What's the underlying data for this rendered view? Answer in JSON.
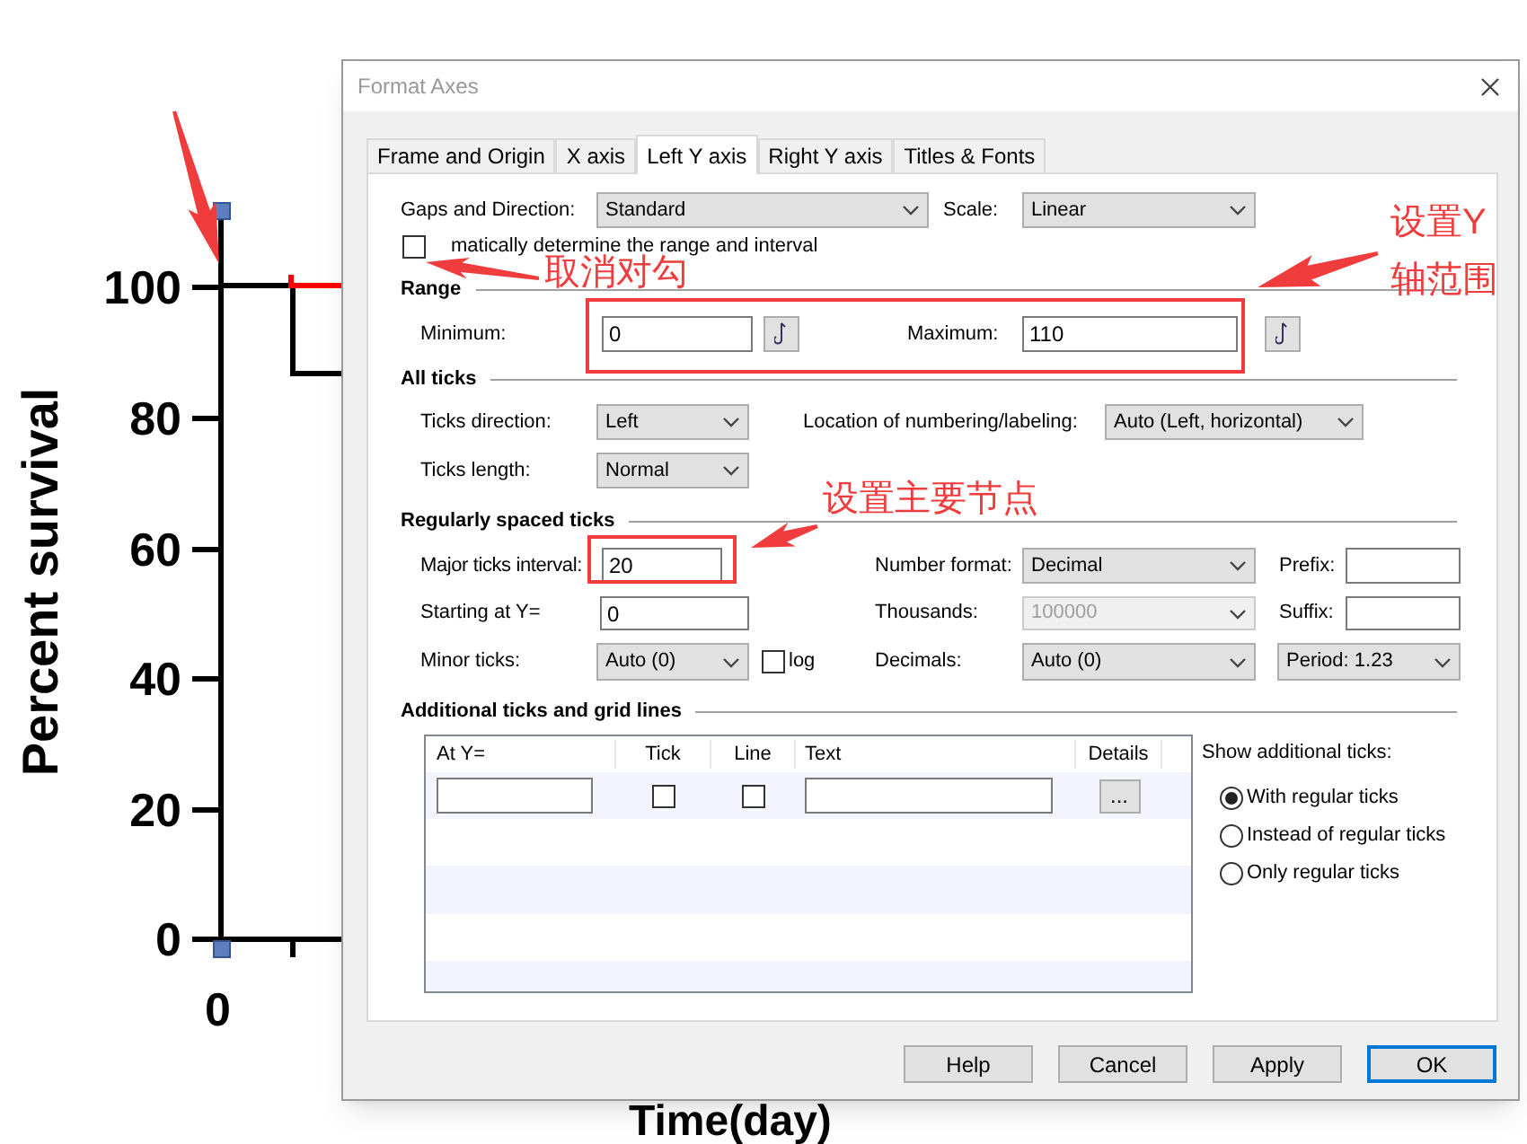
{
  "chart": {
    "y_axis_title": "Percent survival",
    "y_tick_labels": [
      "100",
      "80",
      "60",
      "40",
      "20",
      "0"
    ],
    "x_tick_labels": [
      "0"
    ],
    "x_axis_title": "Time(day)"
  },
  "dialog": {
    "title": "Format Axes",
    "tabs": [
      {
        "label": "Frame and Origin",
        "selected": false
      },
      {
        "label": "X axis",
        "selected": false
      },
      {
        "label": "Left Y axis",
        "selected": true
      },
      {
        "label": "Right Y axis",
        "selected": false
      },
      {
        "label": "Titles & Fonts",
        "selected": false
      }
    ],
    "gaps_direction": {
      "label": "Gaps and Direction:",
      "value": "Standard"
    },
    "scale": {
      "label": "Scale:",
      "value": "Linear"
    },
    "auto_range": {
      "label": "matically determine the range and interval",
      "checked": false
    },
    "range": {
      "title": "Range",
      "minimum": {
        "label": "Minimum:",
        "value": "0"
      },
      "maximum": {
        "label": "Maximum:",
        "value": "110"
      }
    },
    "all_ticks": {
      "title": "All ticks",
      "ticks_direction": {
        "label": "Ticks direction:",
        "value": "Left"
      },
      "ticks_length": {
        "label": "Ticks length:",
        "value": "Normal"
      },
      "location": {
        "label": "Location of numbering/labeling:",
        "value": "Auto (Left, horizontal)"
      }
    },
    "regular_ticks": {
      "title": "Regularly spaced ticks",
      "major_interval": {
        "label": "Major ticks interval:",
        "value": "20"
      },
      "starting_at": {
        "label": "Starting at Y=",
        "value": "0"
      },
      "minor_ticks": {
        "label": "Minor ticks:",
        "value": "Auto (0)"
      },
      "log": {
        "label": "log",
        "checked": false
      },
      "number_format": {
        "label": "Number format:",
        "value": "Decimal"
      },
      "thousands": {
        "label": "Thousands:",
        "value": "100000",
        "disabled": true
      },
      "decimals": {
        "label": "Decimals:",
        "value": "Auto (0)"
      },
      "prefix": {
        "label": "Prefix:"
      },
      "suffix": {
        "label": "Suffix:"
      },
      "period": {
        "value": "Period: 1.23"
      }
    },
    "additional": {
      "title": "Additional ticks and grid lines",
      "columns": [
        "At Y=",
        "Tick",
        "Line",
        "Text",
        "Details"
      ],
      "rows": [
        {
          "tick": false,
          "line": false,
          "details": "..."
        }
      ],
      "show_label": "Show additional ticks:",
      "options": [
        {
          "label": "With regular ticks",
          "selected": true
        },
        {
          "label": "Instead of regular ticks",
          "selected": false
        },
        {
          "label": "Only regular ticks",
          "selected": false
        }
      ]
    },
    "buttons": [
      {
        "label": "Help",
        "default": false
      },
      {
        "label": "Cancel",
        "default": false
      },
      {
        "label": "Apply",
        "default": false
      },
      {
        "label": "OK",
        "default": true
      }
    ]
  },
  "annotations": [
    {
      "text": "取消对勾"
    },
    {
      "text": "设置Y轴范围"
    },
    {
      "text": "设置主要节点"
    }
  ]
}
